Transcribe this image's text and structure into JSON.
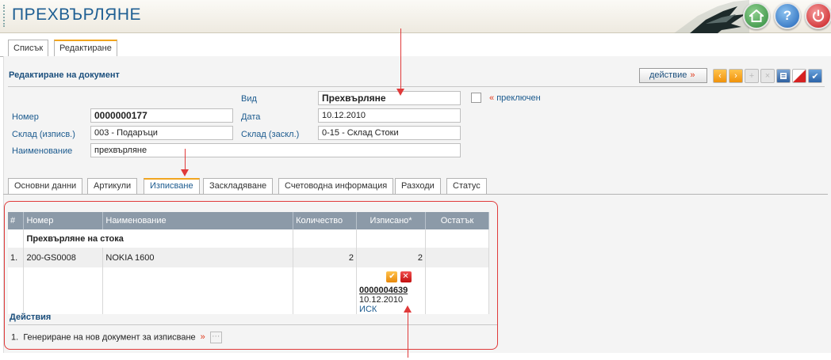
{
  "header": {
    "title": "ПРЕХВЪРЛЯНЕ",
    "home_icon": "home-icon",
    "help_label": "?",
    "power_icon": "power-icon"
  },
  "top_tabs": [
    "Списък",
    "Редактиране"
  ],
  "form": {
    "section_title": "Редактиране на документ",
    "action_label": "действие",
    "action_arrow": "»",
    "vid_label": "Вид",
    "vid_value": "Прехвърляне",
    "switched_label": "преключен",
    "switched_prefix": "«",
    "number_label": "Номер",
    "number_value": "0000000177",
    "date_label": "Дата",
    "date_value": "10.12.2010",
    "warehouse_out_label": "Склад (изписв.)",
    "warehouse_out_value": "003 - Подаръци",
    "warehouse_in_label": "Склад (заскл.)",
    "warehouse_in_value": "0-15 - Склад Стоки",
    "name_label": "Наименование",
    "name_value": "прехвърляне"
  },
  "sub_tabs": [
    "Основни данни",
    "Артикули",
    "Изписване",
    "Заскладяване",
    "Счетоводна информация",
    "Разходи",
    "Статус"
  ],
  "grid": {
    "columns": [
      "#",
      "Номер",
      "Наименование",
      "Количество",
      "Изписано*",
      "Остатък"
    ],
    "group_label": "Прехвърляне на стока",
    "rows": [
      {
        "index": "1.",
        "number": "200-GS0008",
        "name": "NOKIA 1600",
        "qty": "2",
        "written_off": "2",
        "remaining": ""
      }
    ],
    "detail": {
      "doc_number": "0000004639",
      "doc_date": "10.12.2010",
      "doc_type": "ИСК"
    }
  },
  "actions": {
    "title": "Действия",
    "items": [
      {
        "index": "1.",
        "label": "Генериране на нов документ за изписване",
        "arrow": "»"
      }
    ]
  }
}
